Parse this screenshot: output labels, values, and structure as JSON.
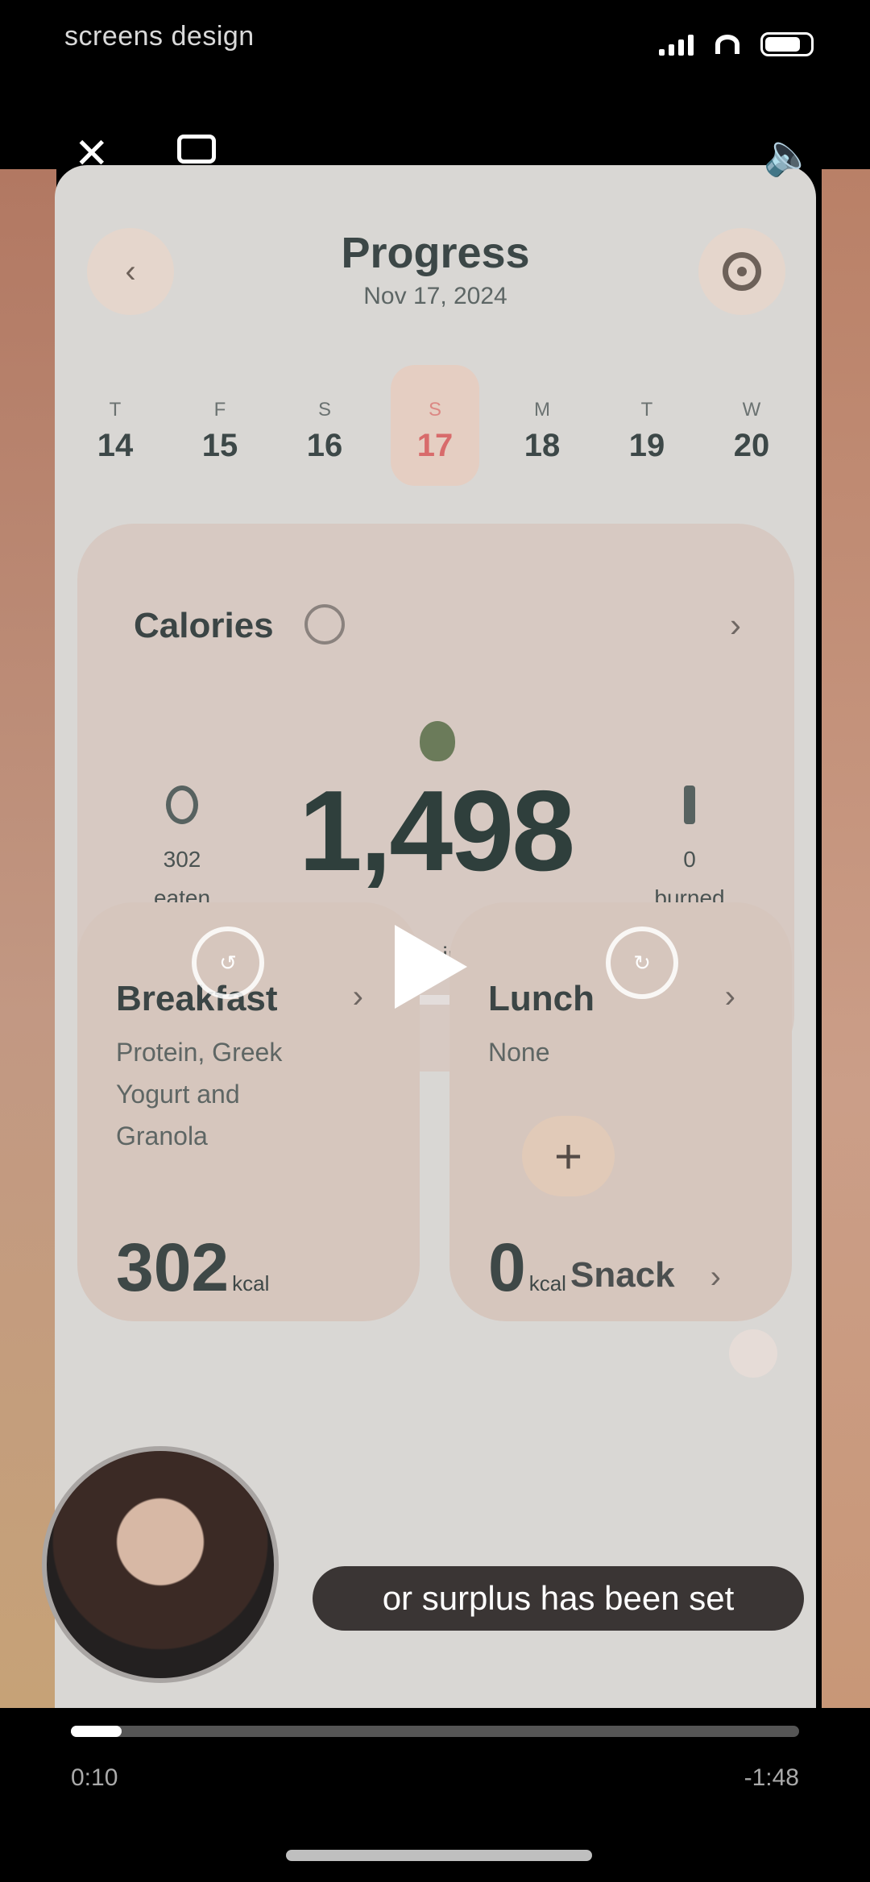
{
  "status_bar": {
    "carrier": "screens design"
  },
  "app": {
    "title": "Progress",
    "date": "Nov 17, 2024",
    "week": [
      {
        "dow": "T",
        "num": "14"
      },
      {
        "dow": "F",
        "num": "15"
      },
      {
        "dow": "S",
        "num": "16"
      },
      {
        "dow": "S",
        "num": "17"
      },
      {
        "dow": "M",
        "num": "18"
      },
      {
        "dow": "T",
        "num": "19"
      },
      {
        "dow": "W",
        "num": "20"
      }
    ],
    "selected_day_index": 3,
    "calories": {
      "title": "Calories",
      "value": "1,498",
      "remaining_label": "Remaining",
      "eaten_value": "302",
      "eaten_label": "eaten",
      "burned_value": "0",
      "burned_label": "burned",
      "progress_fraction": 0.11
    },
    "meals": [
      {
        "name": "Breakfast",
        "desc": "Protein, Greek Yogurt and Granola",
        "kcal": "302",
        "unit": "kcal"
      },
      {
        "name": "Lunch",
        "desc": "None",
        "kcal": "0",
        "unit": "kcal"
      }
    ],
    "snack": {
      "label": "Snack"
    }
  },
  "player": {
    "caption": "or surplus has been set",
    "elapsed": "0:10",
    "remaining": "-1:48",
    "progress_fraction": 0.07
  },
  "colors": {
    "accent_red": "#d5393e",
    "card_bg": "#d7c9c2",
    "text_dark": "#2f3f3c"
  }
}
